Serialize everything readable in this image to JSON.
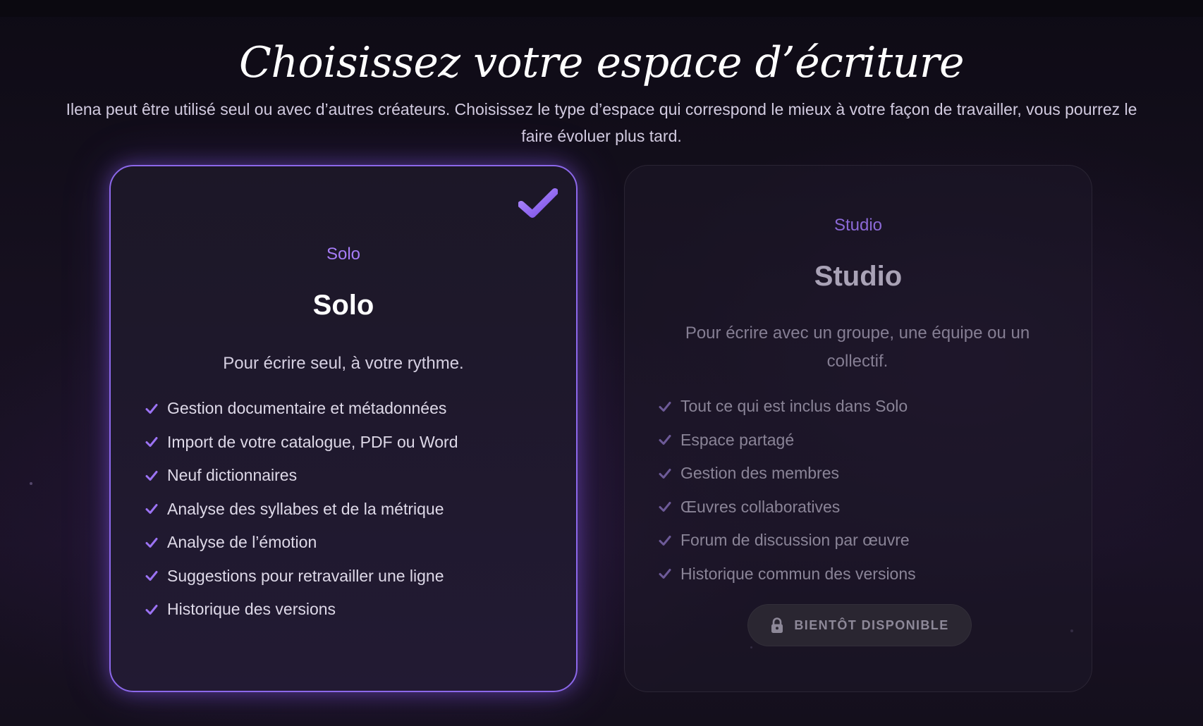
{
  "page": {
    "title": "Choisissez votre espace d’écriture",
    "subtitle": "Ilena peut être utilisé seul ou avec d’autres créateurs. Choisissez le type d’espace qui correspond le mieux à votre façon de travailler, vous pourrez le faire évoluer plus tard."
  },
  "plans": {
    "solo": {
      "kicker": "Solo",
      "title": "Solo",
      "description": "Pour écrire seul, à votre rythme.",
      "selected": true,
      "features": [
        "Gestion documentaire et métadonnées",
        "Import de votre catalogue, PDF ou Word",
        "Neuf dictionnaires",
        "Analyse des syllabes et de la métrique",
        "Analyse de l’émotion",
        "Suggestions pour retravailler une ligne",
        "Historique des versions"
      ]
    },
    "studio": {
      "kicker": "Studio",
      "title": "Studio",
      "description": "Pour écrire avec un groupe, une équipe ou un collectif.",
      "selected": false,
      "features": [
        "Tout ce qui est inclus dans Solo",
        "Espace partagé",
        "Gestion des membres",
        "Œuvres collaboratives",
        "Forum de discussion par œuvre",
        "Historique commun des versions"
      ],
      "button_label": "BIENTÔT DISPONIBLE",
      "button_icon": "lock-icon"
    }
  },
  "colors": {
    "accent": "#8b5cf6",
    "accent_light": "#a67cf7",
    "background": "#16101f",
    "card_solo_border": "#8c68ea",
    "disabled_text": "#8d8898"
  },
  "icons": {
    "selected_marker": "checkmark-icon",
    "feature_bullet": "check-icon"
  }
}
